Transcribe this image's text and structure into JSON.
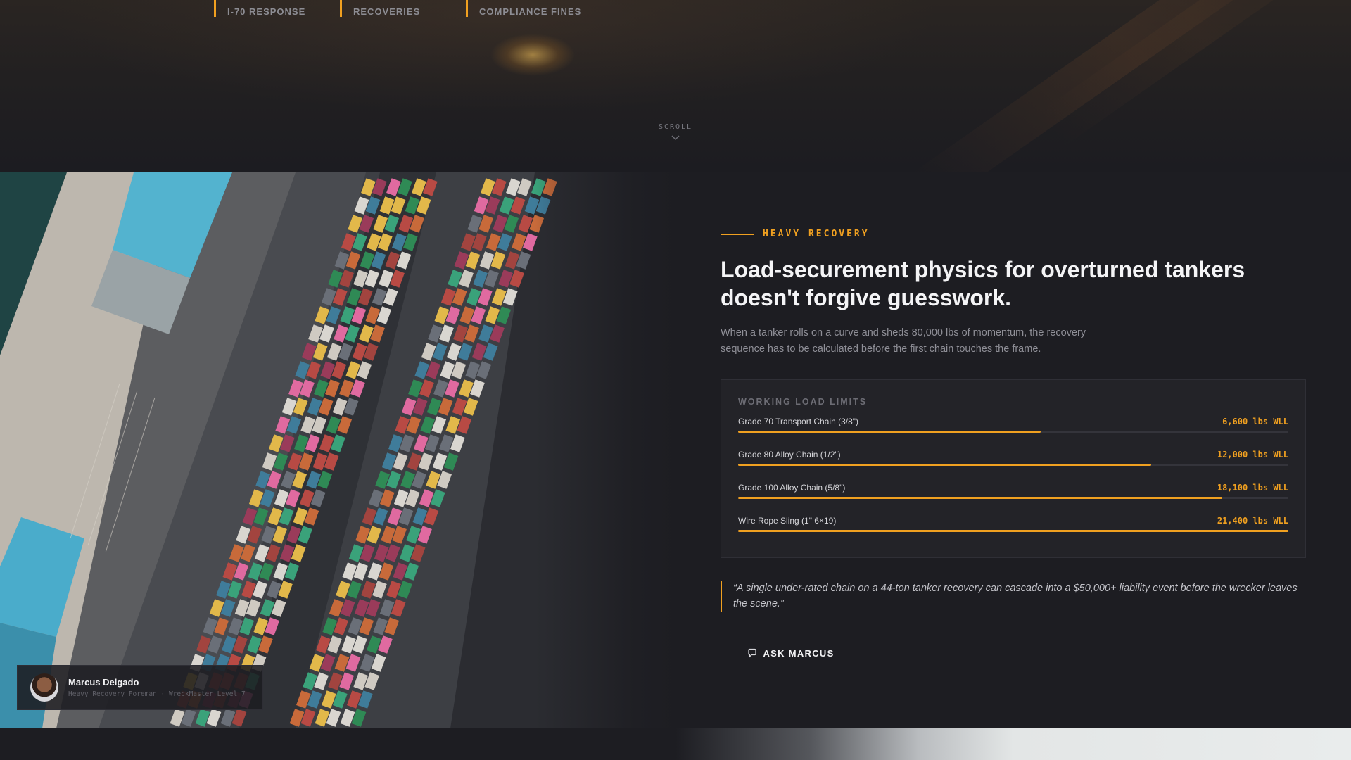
{
  "hero": {
    "stats": [
      {
        "label": "I-70 RESPONSE"
      },
      {
        "label": "RECOVERIES"
      },
      {
        "label": "COMPLIANCE FINES"
      }
    ],
    "scroll_label": "SCROLL"
  },
  "profile": {
    "name": "Marcus Delgado",
    "role": "Heavy Recovery Foreman · WreckMaster Level 7"
  },
  "section": {
    "eyebrow": "HEAVY RECOVERY",
    "headline": "Load-securement physics for overturned tankers doesn't forgive guesswork.",
    "lede": "When a tanker rolls on a curve and sheds 80,000 lbs of momentum, the recovery sequence has to be calculated before the first chain touches the frame.",
    "wll_title": "WORKING LOAD LIMITS",
    "wll": [
      {
        "label": "Grade 70 Transport Chain (3/8\")",
        "value": "6,600 lbs WLL",
        "fraction": 0.55
      },
      {
        "label": "Grade 80 Alloy Chain (1/2\")",
        "value": "12,000 lbs WLL",
        "fraction": 0.75
      },
      {
        "label": "Grade 100 Alloy Chain (5/8\")",
        "value": "18,100 lbs WLL",
        "fraction": 0.88
      },
      {
        "label": "Wire Rope Sling (1\" 6×19)",
        "value": "21,400 lbs WLL",
        "fraction": 1.0
      }
    ],
    "quote": "“A single under-rated chain on a 44-ton tanker recovery can cascade into a $50,000+ liability event before the wrecker leaves the scene.”",
    "cta_label": "ASK MARCUS"
  },
  "colors": {
    "accent": "#f0a020",
    "background": "#1d1d22",
    "panel": "#232328"
  },
  "icons": {
    "scroll": "chevron-down-icon",
    "cta": "chat-bubble-icon"
  }
}
